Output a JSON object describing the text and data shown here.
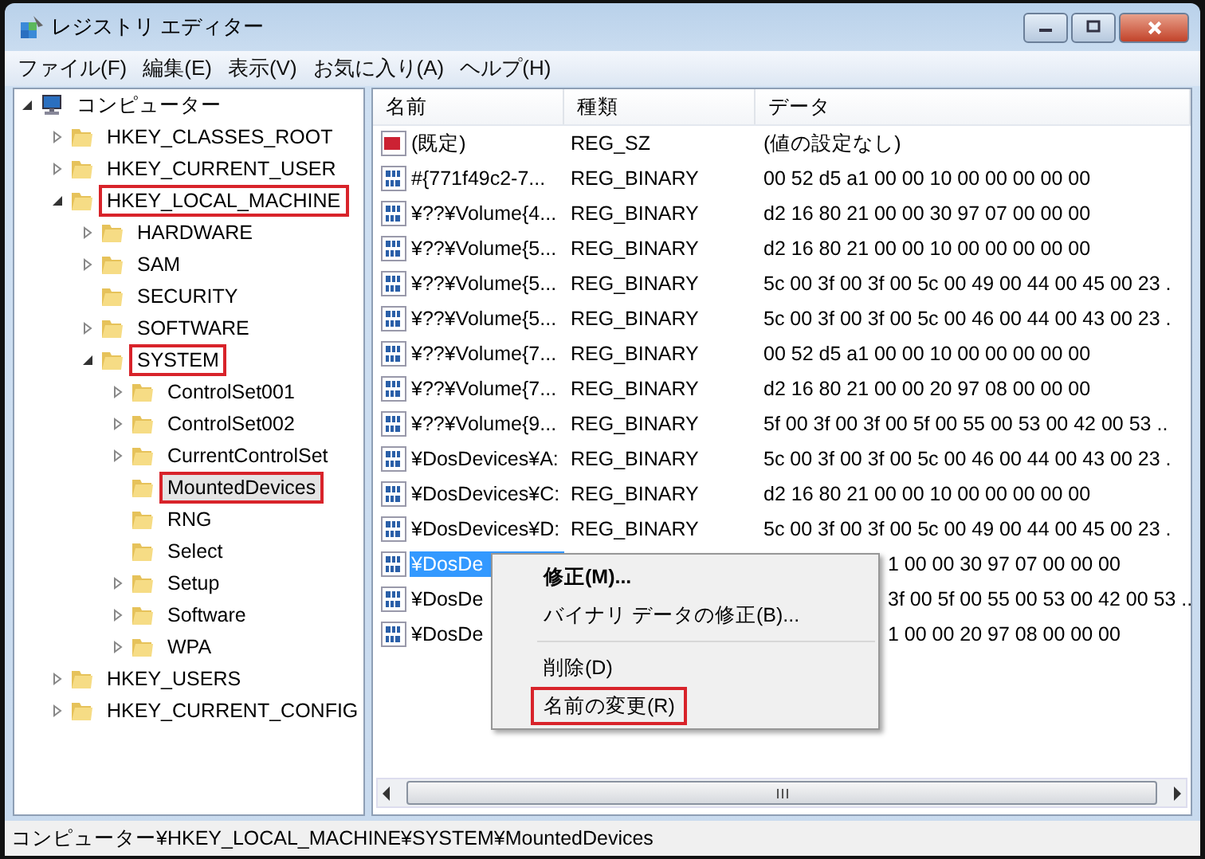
{
  "window": {
    "title": "レジストリ エディター"
  },
  "menu_bar": [
    "ファイル(F)",
    "編集(E)",
    "表示(V)",
    "お気に入り(A)",
    "ヘルプ(H)"
  ],
  "tree": [
    {
      "label": "コンピューター",
      "kind": "computer",
      "expanded": true,
      "selected": false,
      "highlighted": false,
      "children": [
        {
          "label": "HKEY_CLASSES_ROOT",
          "kind": "folder",
          "expanded": false,
          "selected": false,
          "highlighted": false
        },
        {
          "label": "HKEY_CURRENT_USER",
          "kind": "folder",
          "expanded": false,
          "selected": false,
          "highlighted": false
        },
        {
          "label": "HKEY_LOCAL_MACHINE",
          "kind": "folder",
          "expanded": true,
          "selected": false,
          "highlighted": true,
          "children": [
            {
              "label": "HARDWARE",
              "kind": "folder",
              "expanded": false,
              "selected": false,
              "highlighted": false
            },
            {
              "label": "SAM",
              "kind": "folder",
              "expanded": false,
              "selected": false,
              "highlighted": false
            },
            {
              "label": "SECURITY",
              "kind": "folder",
              "selected": false,
              "highlighted": false
            },
            {
              "label": "SOFTWARE",
              "kind": "folder",
              "expanded": false,
              "selected": false,
              "highlighted": false
            },
            {
              "label": "SYSTEM",
              "kind": "folder",
              "expanded": true,
              "selected": false,
              "highlighted": true,
              "children": [
                {
                  "label": "ControlSet001",
                  "kind": "folder",
                  "expanded": false,
                  "selected": false,
                  "highlighted": false
                },
                {
                  "label": "ControlSet002",
                  "kind": "folder",
                  "expanded": false,
                  "selected": false,
                  "highlighted": false
                },
                {
                  "label": "CurrentControlSet",
                  "kind": "folder",
                  "expanded": false,
                  "selected": false,
                  "highlighted": false
                },
                {
                  "label": "MountedDevices",
                  "kind": "folder",
                  "selected": true,
                  "highlighted": true
                },
                {
                  "label": "RNG",
                  "kind": "folder",
                  "selected": false,
                  "highlighted": false
                },
                {
                  "label": "Select",
                  "kind": "folder",
                  "selected": false,
                  "highlighted": false
                },
                {
                  "label": "Setup",
                  "kind": "folder",
                  "expanded": false,
                  "selected": false,
                  "highlighted": false
                },
                {
                  "label": "Software",
                  "kind": "folder",
                  "expanded": false,
                  "selected": false,
                  "highlighted": false
                },
                {
                  "label": "WPA",
                  "kind": "folder",
                  "expanded": false,
                  "selected": false,
                  "highlighted": false
                }
              ]
            }
          ]
        },
        {
          "label": "HKEY_USERS",
          "kind": "folder",
          "expanded": false,
          "selected": false,
          "highlighted": false
        },
        {
          "label": "HKEY_CURRENT_CONFIG",
          "kind": "folder",
          "expanded": false,
          "selected": false,
          "highlighted": false
        }
      ]
    }
  ],
  "table": {
    "columns": [
      "名前",
      "種類",
      "データ"
    ],
    "rows": [
      {
        "kind": "string",
        "covered": false,
        "selected": false,
        "name": "(既定)",
        "type": "REG_SZ",
        "data": "(値の設定なし)"
      },
      {
        "kind": "binary",
        "covered": false,
        "selected": false,
        "name": "#{771f49c2-7...",
        "type": "REG_BINARY",
        "data": "00 52 d5 a1 00 00 10 00 00 00 00 00"
      },
      {
        "kind": "binary",
        "covered": false,
        "selected": false,
        "name": "¥??¥Volume{4...",
        "type": "REG_BINARY",
        "data": "d2 16 80 21 00 00 30 97 07 00 00 00"
      },
      {
        "kind": "binary",
        "covered": false,
        "selected": false,
        "name": "¥??¥Volume{5...",
        "type": "REG_BINARY",
        "data": "d2 16 80 21 00 00 10 00 00 00 00 00"
      },
      {
        "kind": "binary",
        "covered": false,
        "selected": false,
        "name": "¥??¥Volume{5...",
        "type": "REG_BINARY",
        "data": "5c 00 3f 00 3f 00 5c 00 49 00 44 00 45 00 23 ."
      },
      {
        "kind": "binary",
        "covered": false,
        "selected": false,
        "name": "¥??¥Volume{5...",
        "type": "REG_BINARY",
        "data": "5c 00 3f 00 3f 00 5c 00 46 00 44 00 43 00 23 ."
      },
      {
        "kind": "binary",
        "covered": false,
        "selected": false,
        "name": "¥??¥Volume{7...",
        "type": "REG_BINARY",
        "data": "00 52 d5 a1 00 00 10 00 00 00 00 00"
      },
      {
        "kind": "binary",
        "covered": false,
        "selected": false,
        "name": "¥??¥Volume{7...",
        "type": "REG_BINARY",
        "data": "d2 16 80 21 00 00 20 97 08 00 00 00"
      },
      {
        "kind": "binary",
        "covered": false,
        "selected": false,
        "name": "¥??¥Volume{9...",
        "type": "REG_BINARY",
        "data": "5f 00 3f 00 3f 00 5f 00 55 00 53 00 42 00 53 .."
      },
      {
        "kind": "binary",
        "covered": false,
        "selected": false,
        "name": "¥DosDevices¥A:",
        "type": "REG_BINARY",
        "data": "5c 00 3f 00 3f 00 5c 00 46 00 44 00 43 00 23 ."
      },
      {
        "kind": "binary",
        "covered": false,
        "selected": false,
        "name": "¥DosDevices¥C:",
        "type": "REG_BINARY",
        "data": "d2 16 80 21 00 00 10 00 00 00 00 00"
      },
      {
        "kind": "binary",
        "covered": false,
        "selected": false,
        "name": "¥DosDevices¥D:",
        "type": "REG_BINARY",
        "data": "5c 00 3f 00 3f 00 5c 00 49 00 44 00 45 00 23 ."
      },
      {
        "kind": "binary",
        "covered": true,
        "selected": true,
        "name": "¥DosDe",
        "data": "1 00 00 30 97 07 00 00 00"
      },
      {
        "kind": "binary",
        "covered": true,
        "selected": false,
        "name": "¥DosDe",
        "data": "3f 00 5f 00 55 00 53 00 42 00 53 .."
      },
      {
        "kind": "binary",
        "covered": true,
        "selected": false,
        "name": "¥DosDe",
        "data": "1 00 00 20 97 08 00 00 00"
      }
    ]
  },
  "context_menu": [
    {
      "kind": "item",
      "label": "修正(M)...",
      "bold": true,
      "highlighted": false
    },
    {
      "kind": "item",
      "label": "バイナリ データの修正(B)...",
      "bold": false,
      "highlighted": false
    },
    {
      "kind": "separator"
    },
    {
      "kind": "item",
      "label": "削除(D)",
      "bold": false,
      "highlighted": false
    },
    {
      "kind": "item",
      "label": "名前の変更(R)",
      "bold": false,
      "highlighted": true
    }
  ],
  "status_bar": "コンピューター¥HKEY_LOCAL_MACHINE¥SYSTEM¥MountedDevices"
}
